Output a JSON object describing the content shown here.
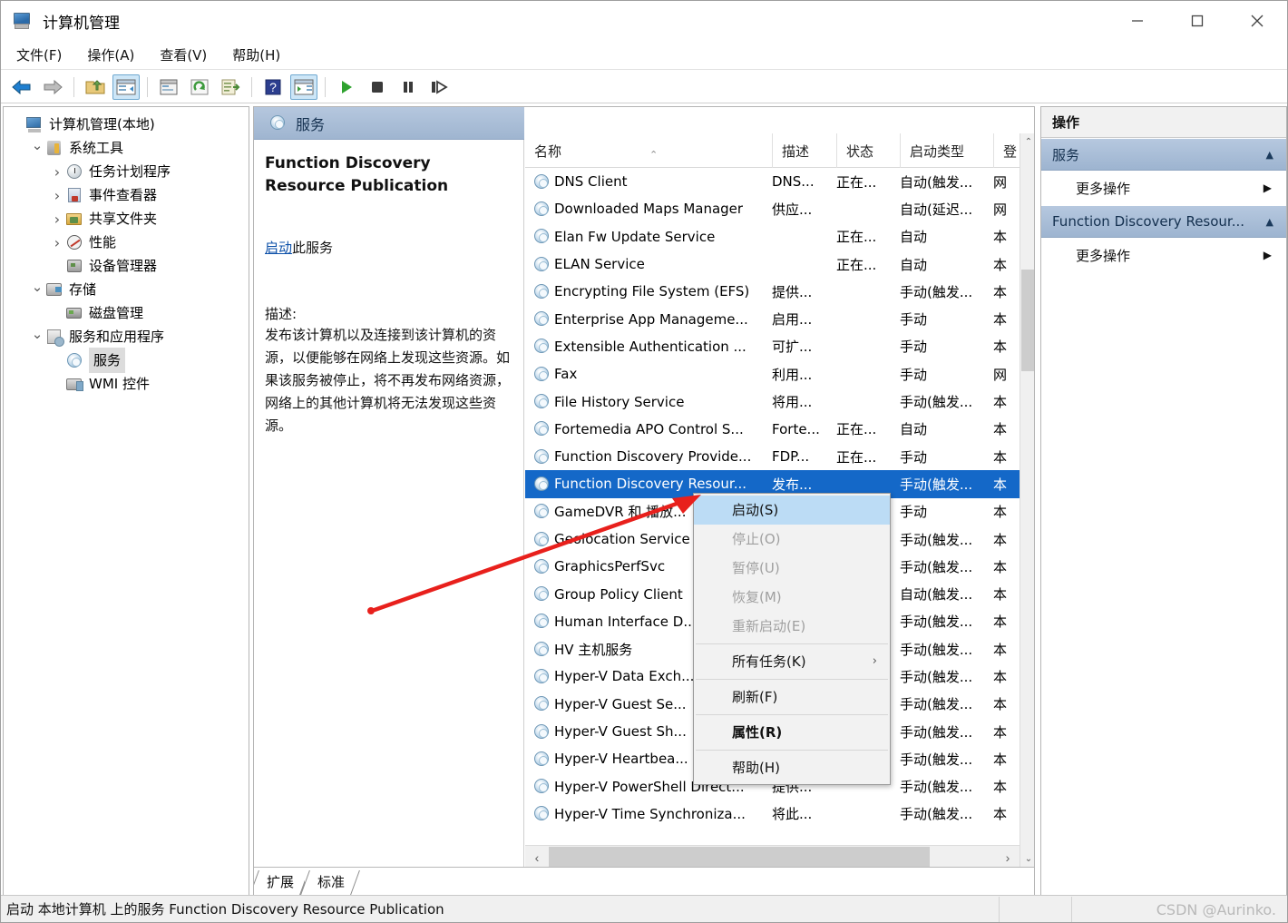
{
  "window": {
    "title": "计算机管理",
    "icon": "computer-management-icon",
    "minimize": "−",
    "maximize": "□",
    "close": "✕"
  },
  "menubar": {
    "items": [
      {
        "label": "文件(F)",
        "name": "menu-file"
      },
      {
        "label": "操作(A)",
        "name": "menu-action"
      },
      {
        "label": "查看(V)",
        "name": "menu-view"
      },
      {
        "label": "帮助(H)",
        "name": "menu-help"
      }
    ]
  },
  "toolbar": {
    "buttons": [
      {
        "name": "back-icon",
        "glyph": "←"
      },
      {
        "name": "forward-icon",
        "glyph": "→"
      },
      {
        "name": "up-folder-icon",
        "glyph": "↑"
      },
      {
        "name": "show-hide-tree-icon",
        "glyph": "▤",
        "active": true
      },
      {
        "name": "properties-icon",
        "glyph": "▣"
      },
      {
        "name": "refresh-icon",
        "glyph": "⟳"
      },
      {
        "name": "export-list-icon",
        "glyph": "⇥"
      },
      {
        "name": "help-icon",
        "glyph": "?"
      },
      {
        "name": "show-action-pane-icon",
        "glyph": "▥",
        "active": true
      },
      {
        "name": "start-service-icon",
        "glyph": "▶"
      },
      {
        "name": "stop-service-icon",
        "glyph": "■"
      },
      {
        "name": "pause-service-icon",
        "glyph": "❚❚"
      },
      {
        "name": "restart-service-icon",
        "glyph": "❙▶"
      }
    ]
  },
  "tree": {
    "nodes": [
      {
        "label": "计算机管理(本地)",
        "indent": 0,
        "chevron": "none",
        "icon": "computer-icon",
        "selected": false
      },
      {
        "label": "系统工具",
        "indent": 1,
        "chevron": "down",
        "icon": "tools-icon",
        "selected": false
      },
      {
        "label": "任务计划程序",
        "indent": 2,
        "chevron": "right",
        "icon": "clock-icon",
        "selected": false
      },
      {
        "label": "事件查看器",
        "indent": 2,
        "chevron": "right",
        "icon": "event-viewer-icon",
        "selected": false
      },
      {
        "label": "共享文件夹",
        "indent": 2,
        "chevron": "right",
        "icon": "shared-folder-icon",
        "selected": false
      },
      {
        "label": "性能",
        "indent": 2,
        "chevron": "right",
        "icon": "performance-icon",
        "selected": false
      },
      {
        "label": "设备管理器",
        "indent": 2,
        "chevron": "none",
        "icon": "device-manager-icon",
        "selected": false
      },
      {
        "label": "存储",
        "indent": 1,
        "chevron": "down",
        "icon": "storage-icon",
        "selected": false
      },
      {
        "label": "磁盘管理",
        "indent": 2,
        "chevron": "none",
        "icon": "disk-management-icon",
        "selected": false
      },
      {
        "label": "服务和应用程序",
        "indent": 1,
        "chevron": "down",
        "icon": "services-apps-icon",
        "selected": false
      },
      {
        "label": "服务",
        "indent": 2,
        "chevron": "none",
        "icon": "service-gear-icon",
        "selected": true
      },
      {
        "label": "WMI 控件",
        "indent": 2,
        "chevron": "none",
        "icon": "wmi-control-icon",
        "selected": false
      }
    ]
  },
  "services_pane": {
    "header_title": "服务",
    "header_icon": "service-gear-icon",
    "detail": {
      "title": "Function Discovery Resource Publication",
      "action_link": "启动",
      "action_suffix": "此服务",
      "description_label": "描述:",
      "description": "发布该计算机以及连接到该计算机的资源，以便能够在网络上发现这些资源。如果该服务被停止，将不再发布网络资源，网络上的其他计算机将无法发现这些资源。"
    },
    "columns": [
      {
        "label": "名称",
        "name": "column-name",
        "sorted": true
      },
      {
        "label": "描述",
        "name": "column-description",
        "sorted": false
      },
      {
        "label": "状态",
        "name": "column-status",
        "sorted": false
      },
      {
        "label": "启动类型",
        "name": "column-startup-type",
        "sorted": false
      },
      {
        "label": "登",
        "name": "column-logon-as",
        "sorted": false
      }
    ],
    "rows": [
      {
        "name": "DNS Client",
        "desc": "DNS...",
        "status": "正在...",
        "startup": "自动(触发...",
        "logon": "网",
        "selected": false
      },
      {
        "name": "Downloaded Maps Manager",
        "desc": "供应...",
        "status": "",
        "startup": "自动(延迟...",
        "logon": "网",
        "selected": false
      },
      {
        "name": "Elan Fw Update Service",
        "desc": "",
        "status": "正在...",
        "startup": "自动",
        "logon": "本",
        "selected": false
      },
      {
        "name": "ELAN Service",
        "desc": "",
        "status": "正在...",
        "startup": "自动",
        "logon": "本",
        "selected": false
      },
      {
        "name": "Encrypting File System (EFS)",
        "desc": "提供...",
        "status": "",
        "startup": "手动(触发...",
        "logon": "本",
        "selected": false
      },
      {
        "name": "Enterprise App Manageme...",
        "desc": "启用...",
        "status": "",
        "startup": "手动",
        "logon": "本",
        "selected": false
      },
      {
        "name": "Extensible Authentication ...",
        "desc": "可扩...",
        "status": "",
        "startup": "手动",
        "logon": "本",
        "selected": false
      },
      {
        "name": "Fax",
        "desc": "利用...",
        "status": "",
        "startup": "手动",
        "logon": "网",
        "selected": false
      },
      {
        "name": "File History Service",
        "desc": "将用...",
        "status": "",
        "startup": "手动(触发...",
        "logon": "本",
        "selected": false
      },
      {
        "name": "Fortemedia APO Control S...",
        "desc": "Forte...",
        "status": "正在...",
        "startup": "自动",
        "logon": "本",
        "selected": false
      },
      {
        "name": "Function Discovery Provide...",
        "desc": "FDP...",
        "status": "正在...",
        "startup": "手动",
        "logon": "本",
        "selected": false
      },
      {
        "name": "Function Discovery Resour...",
        "desc": "发布...",
        "status": "",
        "startup": "手动(触发...",
        "logon": "本",
        "selected": true
      },
      {
        "name": "GameDVR 和 播放...",
        "desc": "",
        "status": "",
        "startup": "手动",
        "logon": "本",
        "selected": false
      },
      {
        "name": "Geolocation Service",
        "desc": "",
        "status": "",
        "startup": "手动(触发...",
        "logon": "本",
        "selected": false
      },
      {
        "name": "GraphicsPerfSvc",
        "desc": "",
        "status": "",
        "startup": "手动(触发...",
        "logon": "本",
        "selected": false
      },
      {
        "name": "Group Policy Client",
        "desc": "",
        "status": "",
        "startup": "自动(触发...",
        "logon": "本",
        "selected": false
      },
      {
        "name": "Human Interface D...",
        "desc": "",
        "status": "",
        "startup": "手动(触发...",
        "logon": "本",
        "selected": false
      },
      {
        "name": "HV 主机服务",
        "desc": "",
        "status": "",
        "startup": "手动(触发...",
        "logon": "本",
        "selected": false
      },
      {
        "name": "Hyper-V Data Exch...",
        "desc": "",
        "status": "",
        "startup": "手动(触发...",
        "logon": "本",
        "selected": false
      },
      {
        "name": "Hyper-V Guest Se...",
        "desc": "",
        "status": "",
        "startup": "手动(触发...",
        "logon": "本",
        "selected": false
      },
      {
        "name": "Hyper-V Guest Sh...",
        "desc": "",
        "status": "",
        "startup": "手动(触发...",
        "logon": "本",
        "selected": false
      },
      {
        "name": "Hyper-V Heartbea...",
        "desc": "",
        "status": "",
        "startup": "手动(触发...",
        "logon": "本",
        "selected": false
      },
      {
        "name": "Hyper-V PowerShell Direct...",
        "desc": "提供...",
        "status": "",
        "startup": "手动(触发...",
        "logon": "本",
        "selected": false
      },
      {
        "name": "Hyper-V Time Synchroniza...",
        "desc": "将此...",
        "status": "",
        "startup": "手动(触发...",
        "logon": "本",
        "selected": false
      }
    ],
    "tabs": [
      {
        "label": "扩展",
        "name": "tab-extended"
      },
      {
        "label": "标准",
        "name": "tab-standard"
      }
    ]
  },
  "context_menu": {
    "items": [
      {
        "label": "启动(S)",
        "name": "ctx-start",
        "state": "highlighted"
      },
      {
        "label": "停止(O)",
        "name": "ctx-stop",
        "state": "disabled"
      },
      {
        "label": "暂停(U)",
        "name": "ctx-pause",
        "state": "disabled"
      },
      {
        "label": "恢复(M)",
        "name": "ctx-resume",
        "state": "disabled"
      },
      {
        "label": "重新启动(E)",
        "name": "ctx-restart",
        "state": "disabled"
      },
      {
        "separator": true
      },
      {
        "label": "所有任务(K)",
        "name": "ctx-all-tasks",
        "state": "normal",
        "submenu": "›"
      },
      {
        "separator": true
      },
      {
        "label": "刷新(F)",
        "name": "ctx-refresh",
        "state": "normal"
      },
      {
        "separator": true
      },
      {
        "label": "属性(R)",
        "name": "ctx-properties",
        "state": "bold"
      },
      {
        "separator": true
      },
      {
        "label": "帮助(H)",
        "name": "ctx-help",
        "state": "normal"
      }
    ]
  },
  "actions_pane": {
    "title": "操作",
    "groups": [
      {
        "label": "服务",
        "name": "action-group-services",
        "caret": "▲",
        "items": [
          {
            "label": "更多操作",
            "name": "action-more-services",
            "arrow": "▶"
          }
        ]
      },
      {
        "label": "Function Discovery Resour...",
        "name": "action-group-fdrp",
        "caret": "▲",
        "items": [
          {
            "label": "更多操作",
            "name": "action-more-fdrp",
            "arrow": "▶"
          }
        ]
      }
    ]
  },
  "statusbar": {
    "text": "启动 本地计算机 上的服务 Function Discovery Resource Publication",
    "watermark": "CSDN @Aurinko."
  },
  "colors": {
    "selection_blue": "#1468c8",
    "header_band": "#9fb5d0",
    "menu_highlight": "#bcdcf5",
    "link_blue": "#0b4fa8",
    "annotation_red": "#e8201c"
  }
}
